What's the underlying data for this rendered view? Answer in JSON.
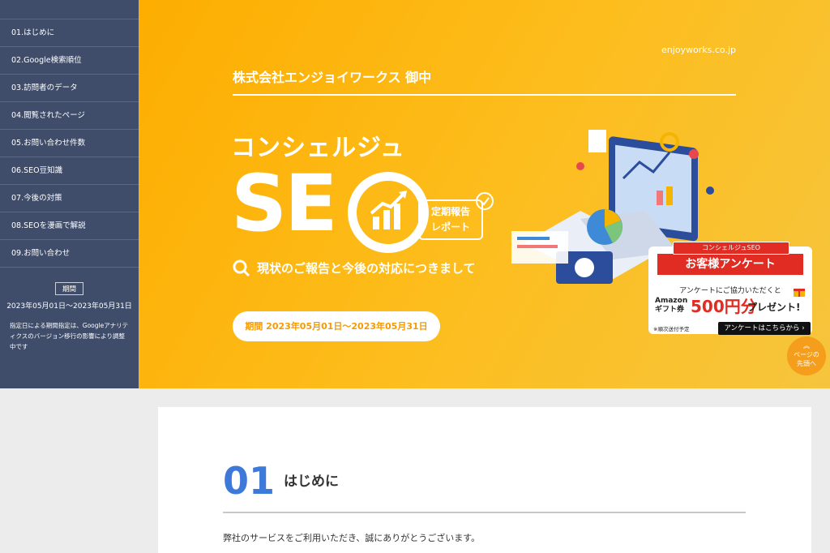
{
  "sidebar": {
    "items": [
      {
        "label": "01.はじめに"
      },
      {
        "label": "02.Google検索順位"
      },
      {
        "label": "03.訪問者のデータ"
      },
      {
        "label": "04.閲覧されたページ"
      },
      {
        "label": "05.お問い合わせ件数"
      },
      {
        "label": "06.SEO豆知識"
      },
      {
        "label": "07.今後の対策"
      },
      {
        "label": "08.SEOを漫画で解説"
      },
      {
        "label": "09.お問い合わせ"
      }
    ],
    "period_label": "期間",
    "period_range": "2023年05月01日〜2023年05月31日",
    "period_note": "指定日による期間指定は、Googleアナリティクスのバージョン移行の影響により調整中です"
  },
  "hero": {
    "domain": "enjoyworks.co.jp",
    "client": "株式会社エンジョイワークス 御中",
    "concierge": "コンシェルジュ",
    "seo_letters": "SE",
    "report_badge_line1": "定期報告",
    "report_badge_line2": "レポート",
    "subtitle": "現状のご報告と今後の対応につきまして",
    "period_pill": "期間 2023年05月01日〜2023年05月31日"
  },
  "survey": {
    "tag": "コンシェルジュSEO",
    "ribbon": "お客様アンケート",
    "line1": "アンケートにご協力いただくと",
    "line2a": "Amazon",
    "line2b": "ギフト券",
    "amount": "500円分",
    "present": "プレゼント!",
    "note": "※順次送付予定",
    "cta": "アンケートはこちらから ›"
  },
  "page_top": {
    "line1": "ページの",
    "line2": "先頭へ"
  },
  "section": {
    "number": "01",
    "title": "はじめに",
    "body": "弊社のサービスをご利用いただき、誠にありがとうございます。"
  },
  "colors": {
    "accent": "#3d79d8",
    "hero": "#fdb30f",
    "sidebar": "#3f4d6b",
    "survey_red": "#e02c22"
  }
}
